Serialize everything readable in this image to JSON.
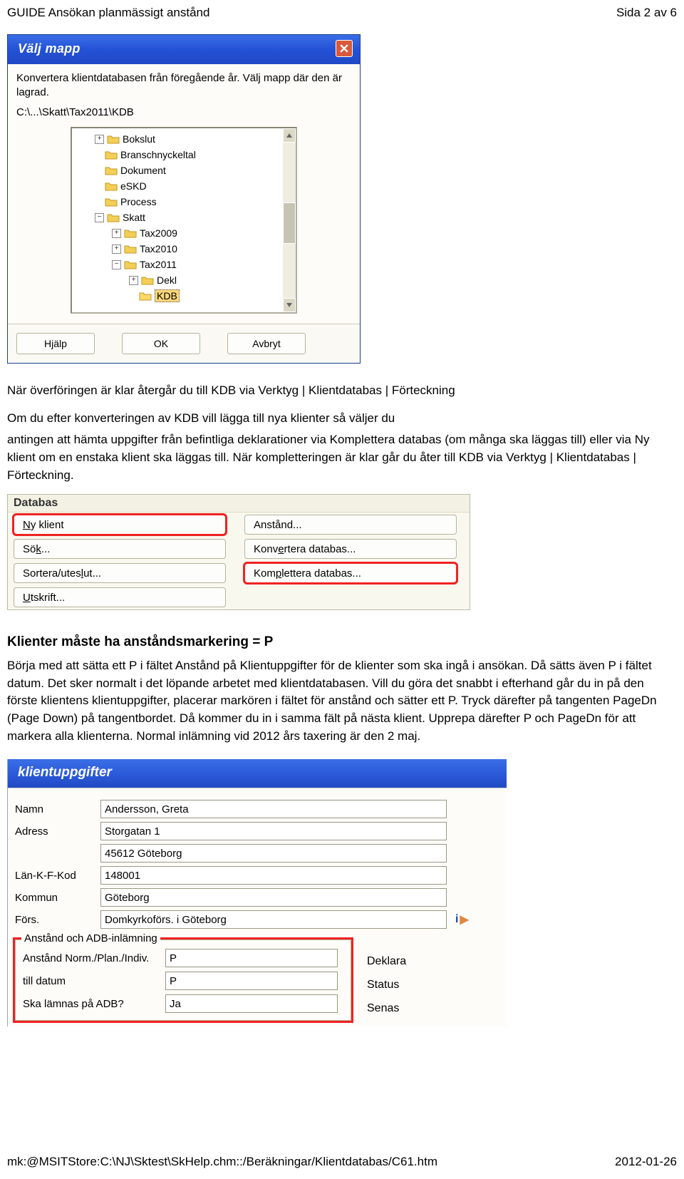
{
  "header": {
    "title": "GUIDE Ansökan planmässigt anstånd",
    "page": "Sida 2 av 6"
  },
  "footer": {
    "path": "mk:@MSITStore:C:\\NJ\\Sktest\\SkHelp.chm::/Beräkningar/Klientdatabas/C61.htm",
    "date": "2012-01-26"
  },
  "dialog": {
    "title": "Välj mapp",
    "desc": "Konvertera klientdatabasen från föregående år. Välj mapp där den är lagrad.",
    "path": "C:\\...\\Skatt\\Tax2011\\KDB",
    "tree": [
      {
        "level": 1,
        "toggle": "+",
        "label": "Bokslut"
      },
      {
        "level": 1,
        "toggle": "",
        "label": "Branschnyckeltal"
      },
      {
        "level": 1,
        "toggle": "",
        "label": "Dokument"
      },
      {
        "level": 1,
        "toggle": "",
        "label": "eSKD"
      },
      {
        "level": 1,
        "toggle": "",
        "label": "Process"
      },
      {
        "level": 1,
        "toggle": "-",
        "label": "Skatt"
      },
      {
        "level": 2,
        "toggle": "+",
        "label": "Tax2009"
      },
      {
        "level": 2,
        "toggle": "+",
        "label": "Tax2010"
      },
      {
        "level": 2,
        "toggle": "-",
        "label": "Tax2011"
      },
      {
        "level": 3,
        "toggle": "+",
        "label": "Dekl"
      },
      {
        "level": 3,
        "toggle": "",
        "label": "KDB",
        "selected": true,
        "open": true
      }
    ],
    "buttons": {
      "help": "Hjälp",
      "ok": "OK",
      "cancel": "Avbryt"
    }
  },
  "para1": "När överföringen är klar återgår du till KDB via  Verktyg | Klientdatabas | Förteckning",
  "para2a": "Om du efter konverteringen av KDB vill lägga till nya klienter så väljer du",
  "para2b": "antingen att hämta uppgifter från befintliga deklarationer via Komplettera databas (om många ska läggas till) eller via Ny klient om en enstaka klient ska läggas till. När kompletteringen är klar går du åter till KDB via Verktyg | Klientdatabas | Förteckning.",
  "db": {
    "header": "Databas",
    "ny": "Ny klient",
    "anstand": "Anstånd...",
    "sok": "Sök...",
    "konv": "Konvertera databas...",
    "sort": "Sortera/uteslut...",
    "kompl": "Komplettera databas...",
    "utskrift": "Utskrift..."
  },
  "section": "Klienter måste ha anståndsmarkering = P",
  "para3": "Börja med att sätta ett P i fältet Anstånd på Klientuppgifter för de klienter som ska ingå i ansökan. Då sätts även P i fältet datum. Det sker normalt i det löpande arbetet med klientdatabasen. Vill du göra det snabbt i efterhand går du in på den förste klientens klientuppgifter, placerar markören i fältet för anstånd och sätter ett P. Tryck därefter på tangenten PageDn (Page Down) på tangentbordet. Då kommer du in i samma fält på nästa klient. Upprepa därefter P och PageDn för att markera alla klienterna. Normal inlämning vid 2012 års taxering är den 2 maj.",
  "form": {
    "title": "klientuppgifter",
    "labels": {
      "namn": "Namn",
      "adress": "Adress",
      "lankfkod": "Län-K-F-Kod",
      "kommun": "Kommun",
      "fors": "Förs."
    },
    "fields": {
      "namn": "Andersson, Greta",
      "adress1": "Storgatan 1",
      "adress2": "45612 Göteborg",
      "lankfkod": "148001",
      "kommun": "Göteborg",
      "fors": "Domkyrkoförs. i Göteborg"
    },
    "group": {
      "legend": "Anstånd och ADB-inlämning",
      "r1_label": "Anstånd Norm./Plan./Indiv.",
      "r1_val": "P",
      "r2_label": "till datum",
      "r2_val": "P",
      "r3_label": "Ska lämnas på ADB?",
      "r3_val": "Ja"
    },
    "right": {
      "deklara": "Deklara",
      "status": "Status",
      "senas": "Senas"
    }
  }
}
